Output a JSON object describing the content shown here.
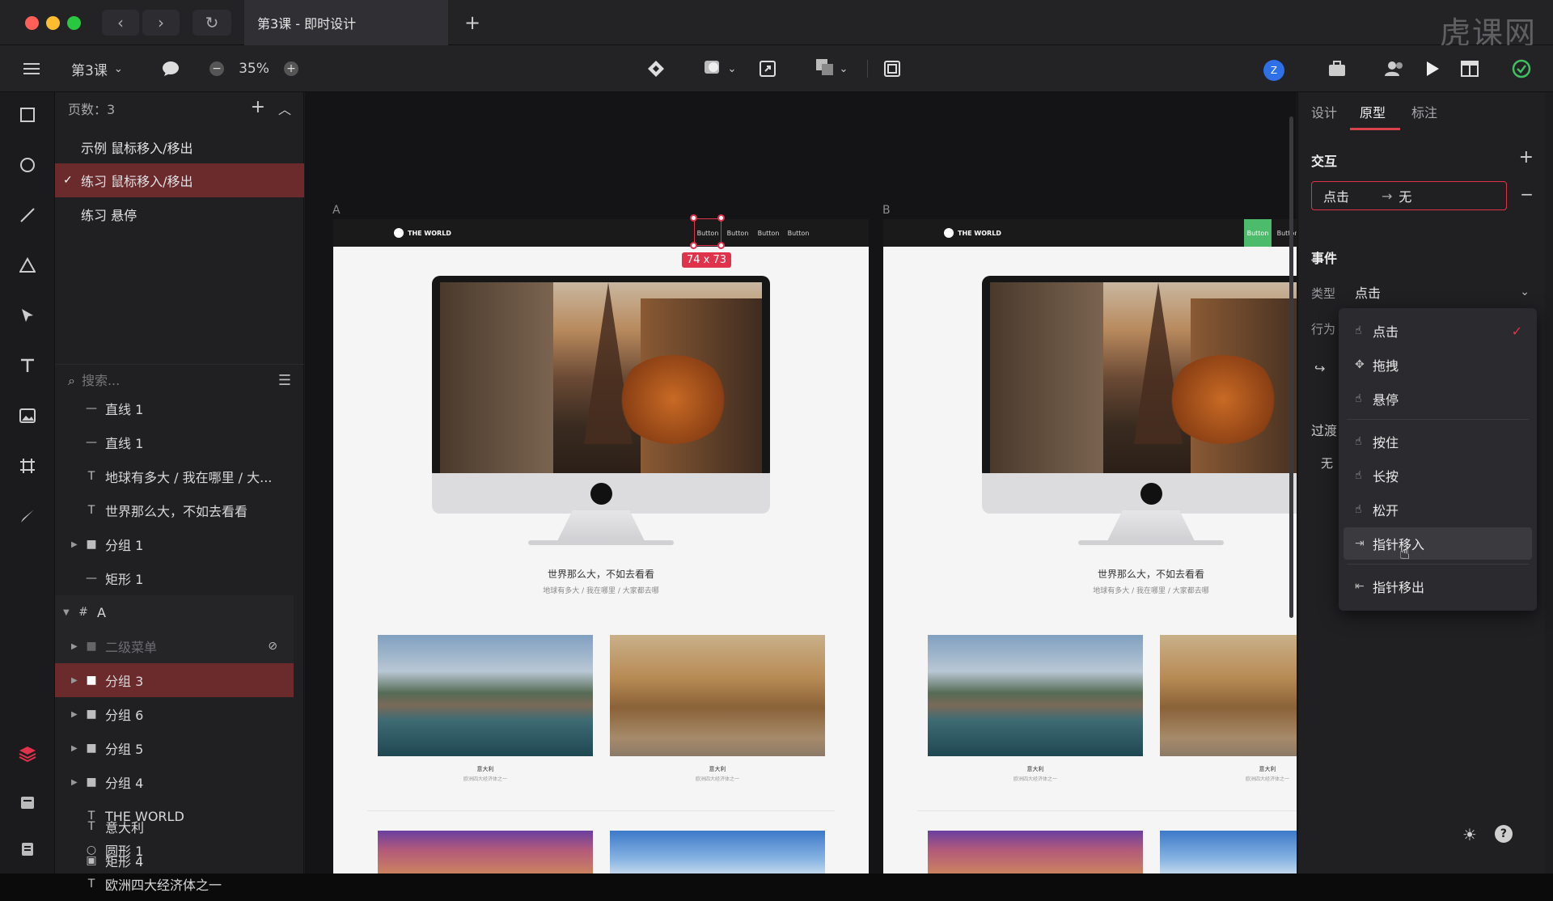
{
  "window": {
    "tab_title": "第3课 - 即时设计",
    "new_tab": "+",
    "watermark": "虎课网"
  },
  "toolbar": {
    "menu_icon": "hamburger-icon",
    "file_name": "第3课",
    "zoom": "35%",
    "zoom_minus": "−",
    "zoom_plus": "+",
    "avatar_letter": "Z"
  },
  "pages": {
    "header": "页数：3",
    "items": [
      {
        "label": "示例 鼠标移入/移出",
        "active": false
      },
      {
        "label": "练习 鼠标移入/移出",
        "active": true
      },
      {
        "label": "练习 悬停",
        "active": false
      }
    ]
  },
  "search": {
    "placeholder": "搜索..."
  },
  "layers": [
    {
      "label": "直线 1",
      "icon": "line-icon"
    },
    {
      "label": "直线 1",
      "icon": "line-icon"
    },
    {
      "label": "地球有多大 / 我在哪里 / 大...",
      "icon": "text-icon"
    },
    {
      "label": "世界那么大，不如去看看",
      "icon": "text-icon"
    },
    {
      "label": "分组 1",
      "icon": "folder-icon"
    },
    {
      "label": "矩形 1",
      "icon": "line-icon"
    },
    {
      "label": "A",
      "icon": "frame-icon"
    },
    {
      "label": "二级菜单",
      "icon": "folder-icon"
    },
    {
      "label": "分组 3",
      "icon": "folder-icon"
    },
    {
      "label": "分组 6",
      "icon": "folder-icon"
    },
    {
      "label": "分组 5",
      "icon": "folder-icon"
    },
    {
      "label": "分组 4",
      "icon": "folder-icon"
    },
    {
      "label": "THE WORLD",
      "icon": "text-icon"
    },
    {
      "label": "圆形 1",
      "icon": "circle-icon"
    },
    {
      "label": "欧洲四大经济体之一",
      "icon": "text-icon"
    },
    {
      "label": "意大利",
      "icon": "text-icon"
    },
    {
      "label": "矩形 4",
      "icon": "image-icon"
    }
  ],
  "canvas": {
    "artboard_a_label": "A",
    "artboard_b_label": "B",
    "logo_text": "THE WORLD",
    "nav_buttons": [
      "Button",
      "Button",
      "Button",
      "Button"
    ],
    "selection_size": "74 x 73",
    "hero_title": "世界那么大，不如去看看",
    "hero_sub": "地球有多大 / 我在哪里 / 大家都去哪",
    "card_title": "意大利",
    "card_sub": "欧洲四大经济体之一"
  },
  "right_panel": {
    "tabs": [
      "设计",
      "原型",
      "标注"
    ],
    "active_tab": "原型",
    "interaction_title": "交互",
    "interaction_from": "点击",
    "interaction_to": "无",
    "event_title": "事件",
    "type_label": "类型",
    "type_value": "点击",
    "behavior_label": "行为",
    "transition_label": "过渡",
    "transition_value": "无"
  },
  "dropdown": {
    "items": [
      {
        "label": "点击",
        "icon": "tap-icon",
        "checked": true
      },
      {
        "label": "拖拽",
        "icon": "drag-icon"
      },
      {
        "label": "悬停",
        "icon": "hover-icon"
      },
      {
        "label": "按住",
        "icon": "press-icon"
      },
      {
        "label": "长按",
        "icon": "long-press-icon"
      },
      {
        "label": "松开",
        "icon": "release-icon"
      },
      {
        "label": "指针移入",
        "icon": "pointer-enter-icon"
      },
      {
        "label": "指针移出",
        "icon": "pointer-leave-icon"
      }
    ],
    "hovered": "指针移入"
  },
  "colors": {
    "accent_red": "#e0334b",
    "selected_row": "#6b2a2c",
    "hover_green": "#4cbb6b",
    "avatar_blue": "#2f6fe8"
  }
}
